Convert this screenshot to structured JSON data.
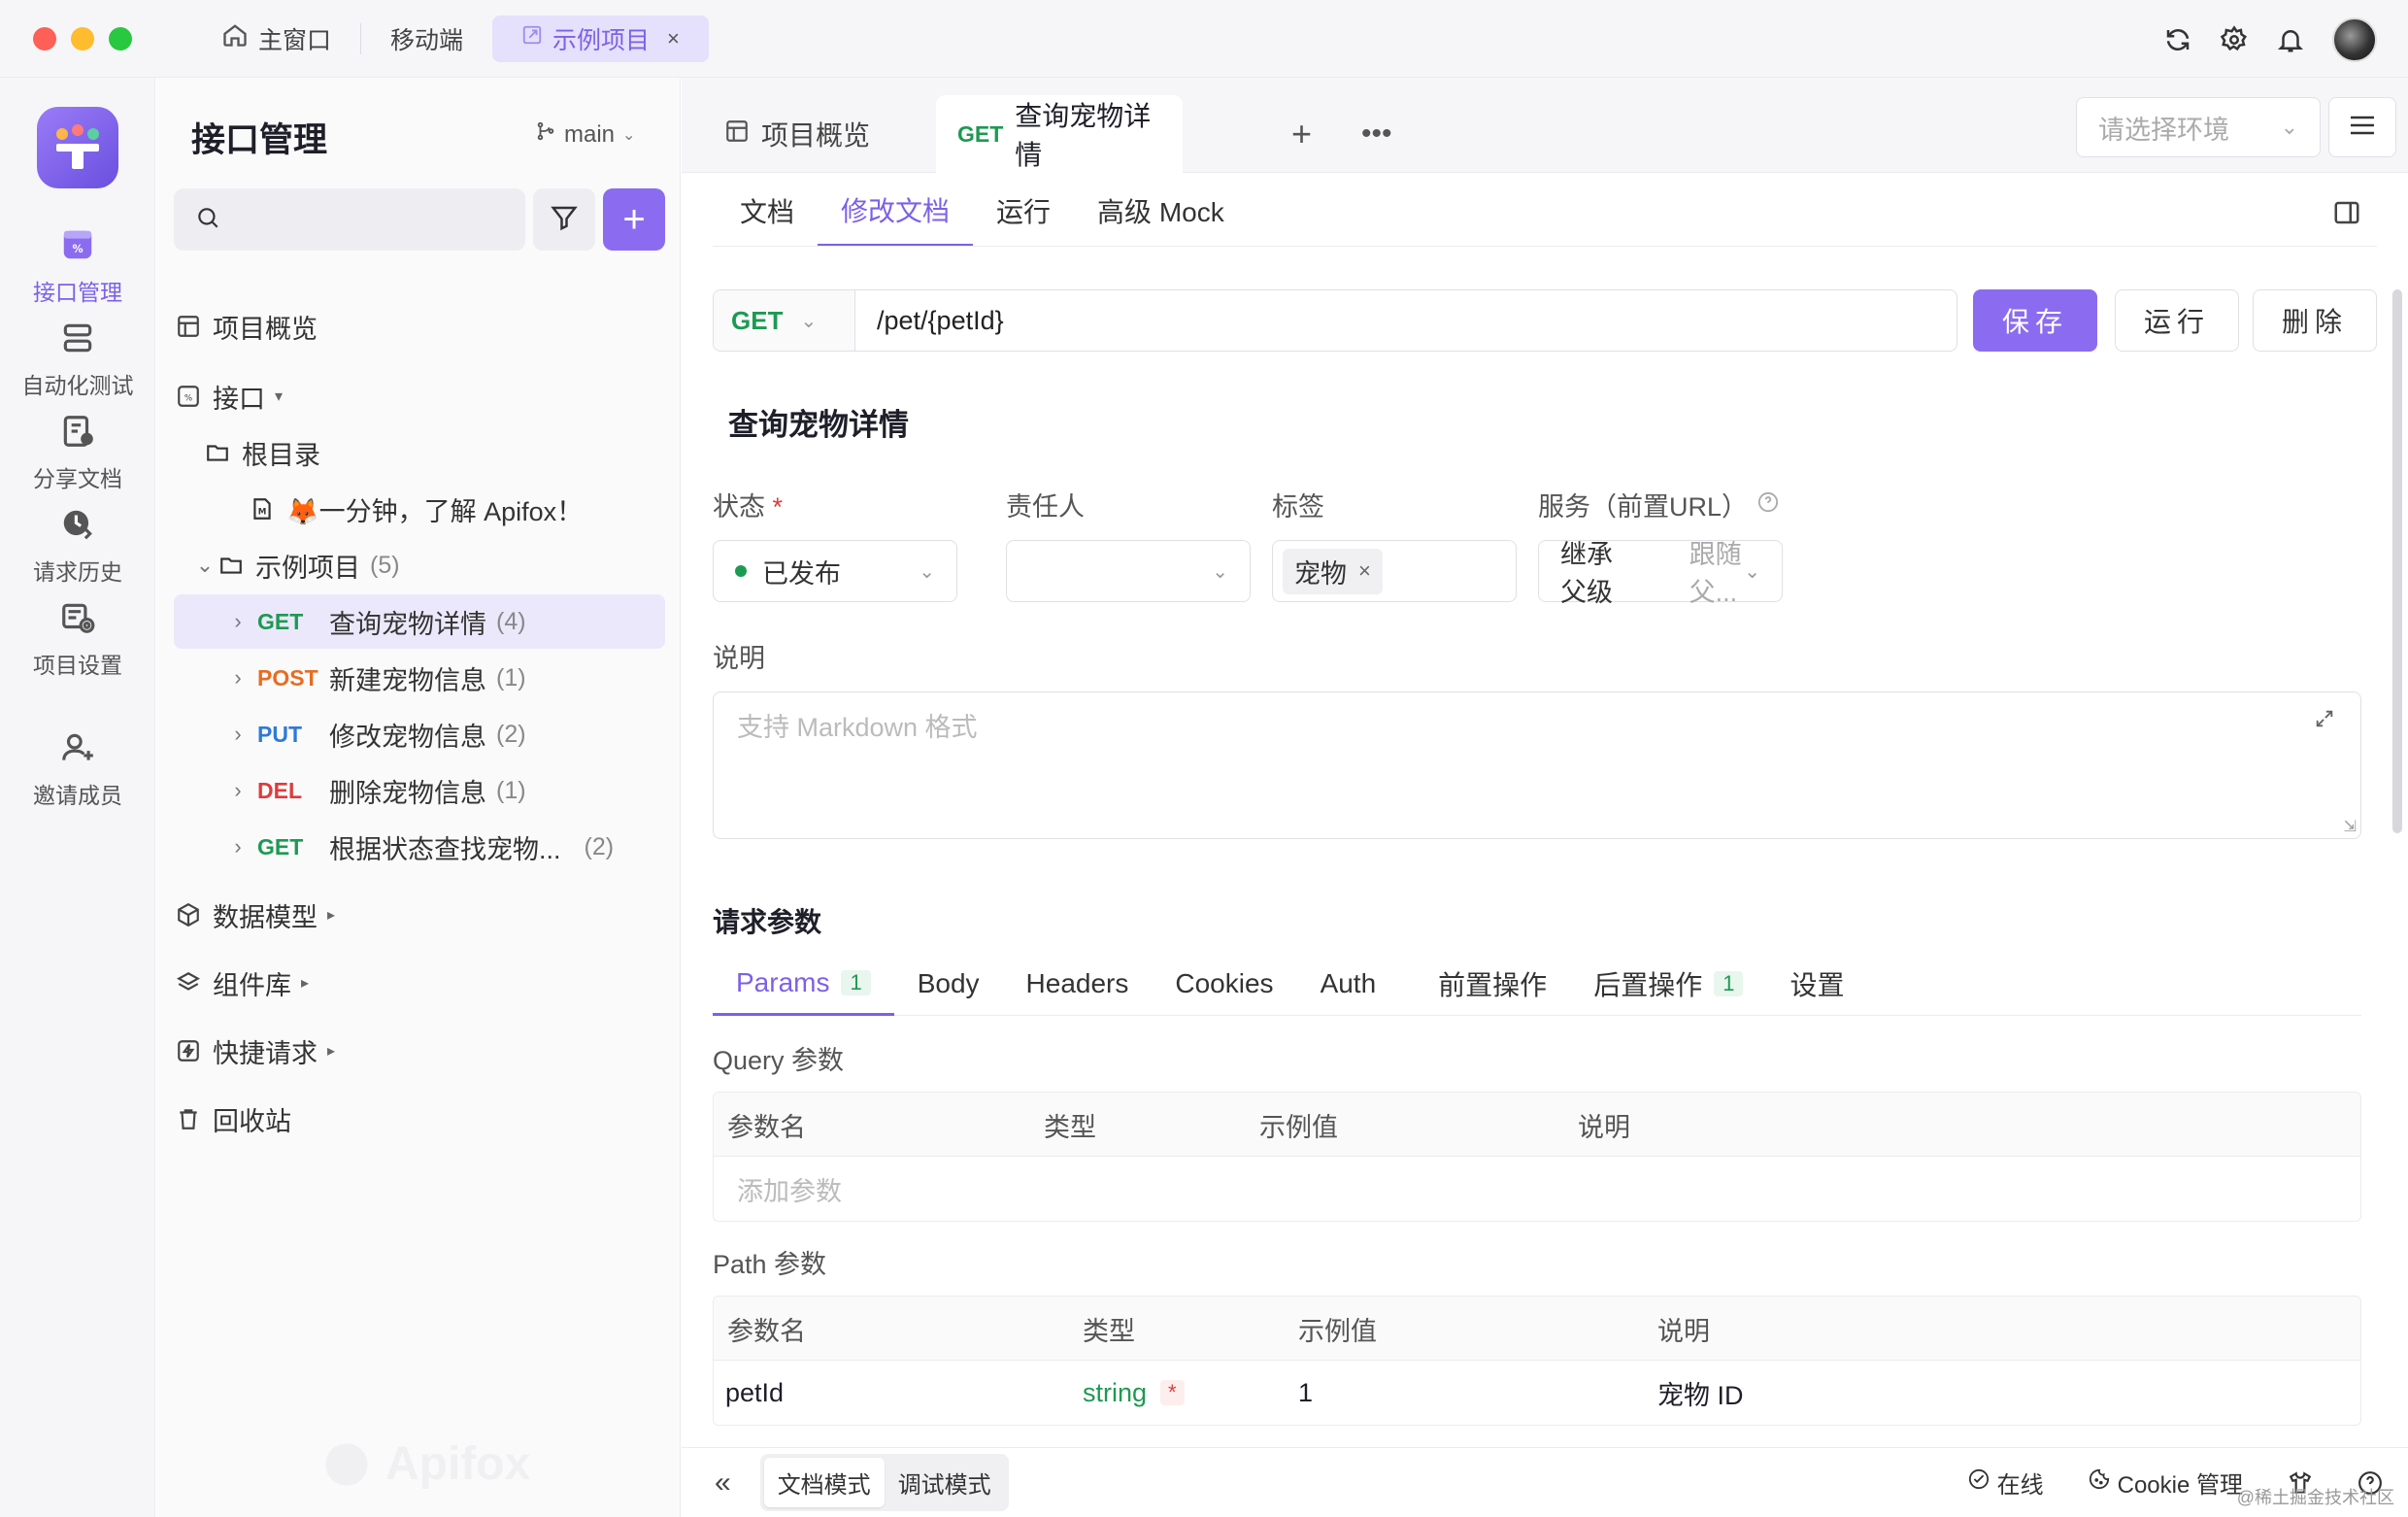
{
  "titlebar": {
    "tabs": [
      {
        "label": "主窗口",
        "icon": "home-icon"
      },
      {
        "label": "移动端"
      },
      {
        "label": "示例项目",
        "icon": "external-icon",
        "close": "×"
      }
    ]
  },
  "leftnav": {
    "items": [
      {
        "label": "接口管理",
        "icon": "api-icon",
        "active": true
      },
      {
        "label": "自动化测试",
        "icon": "automation-icon"
      },
      {
        "label": "分享文档",
        "icon": "share-doc-icon"
      },
      {
        "label": "请求历史",
        "icon": "history-icon"
      },
      {
        "label": "项目设置",
        "icon": "project-settings-icon"
      },
      {
        "label": "邀请成员",
        "icon": "invite-member-icon"
      }
    ]
  },
  "tree": {
    "title": "接口管理",
    "branch": "main",
    "nodes": {
      "overview": "项目概览",
      "api": "接口",
      "root": "根目录",
      "intro": "🦊一分钟，了解 Apifox！",
      "folder": "示例项目",
      "folder_count": "(5)",
      "data_model": "数据模型",
      "components": "组件库",
      "quick_request": "快捷请求",
      "recycle": "回收站"
    },
    "endpoints": [
      {
        "method": "GET",
        "name": "查询宠物详情",
        "count": "(4)"
      },
      {
        "method": "POST",
        "name": "新建宠物信息",
        "count": "(1)"
      },
      {
        "method": "PUT",
        "name": "修改宠物信息",
        "count": "(2)"
      },
      {
        "method": "DEL",
        "name": "删除宠物信息",
        "count": "(1)"
      },
      {
        "method": "GET",
        "name": "根据状态查找宠物...",
        "count": "(2)"
      }
    ],
    "watermark": "Apifox"
  },
  "doctabs": {
    "overview": "项目概览",
    "active_method": "GET",
    "active_title": "查询宠物详情",
    "env_placeholder": "请选择环境"
  },
  "subtabs": [
    "文档",
    "修改文档",
    "运行",
    "高级 Mock"
  ],
  "request": {
    "method": "GET",
    "path": "/pet/{petId}",
    "save": "保存",
    "run": "运行",
    "delete": "删除"
  },
  "api": {
    "name": "查询宠物详情",
    "status_label": "状态",
    "status_value": "已发布",
    "owner_label": "责任人",
    "tag_label": "标签",
    "tag_value": "宠物",
    "service_label": "服务（前置URL）",
    "service_value": "继承父级",
    "service_hint": "跟随父...",
    "desc_label": "说明",
    "desc_placeholder": "支持 Markdown 格式"
  },
  "params": {
    "title": "请求参数",
    "tabs": [
      {
        "label": "Params",
        "badge": "1"
      },
      {
        "label": "Body"
      },
      {
        "label": "Headers"
      },
      {
        "label": "Cookies"
      },
      {
        "label": "Auth"
      },
      {
        "label": "前置操作"
      },
      {
        "label": "后置操作",
        "badge": "1"
      },
      {
        "label": "设置"
      }
    ],
    "query_label": "Query 参数",
    "path_label": "Path 参数",
    "columns": [
      "参数名",
      "类型",
      "示例值",
      "说明"
    ],
    "add_placeholder": "添加参数",
    "path_rows": [
      {
        "name": "petId",
        "type": "string",
        "required": "*",
        "example": "1",
        "desc": "宠物 ID"
      }
    ]
  },
  "bottombar": {
    "doc_mode": "文档模式",
    "debug_mode": "调试模式",
    "online": "在线",
    "cookie": "Cookie 管理"
  },
  "corner_watermark": "@稀土掘金技术社区",
  "colors": {
    "accent": "#8b6cf0",
    "get": "#1d9a52",
    "post": "#e66d22",
    "put": "#2f7ad6",
    "del": "#e03b3b"
  }
}
